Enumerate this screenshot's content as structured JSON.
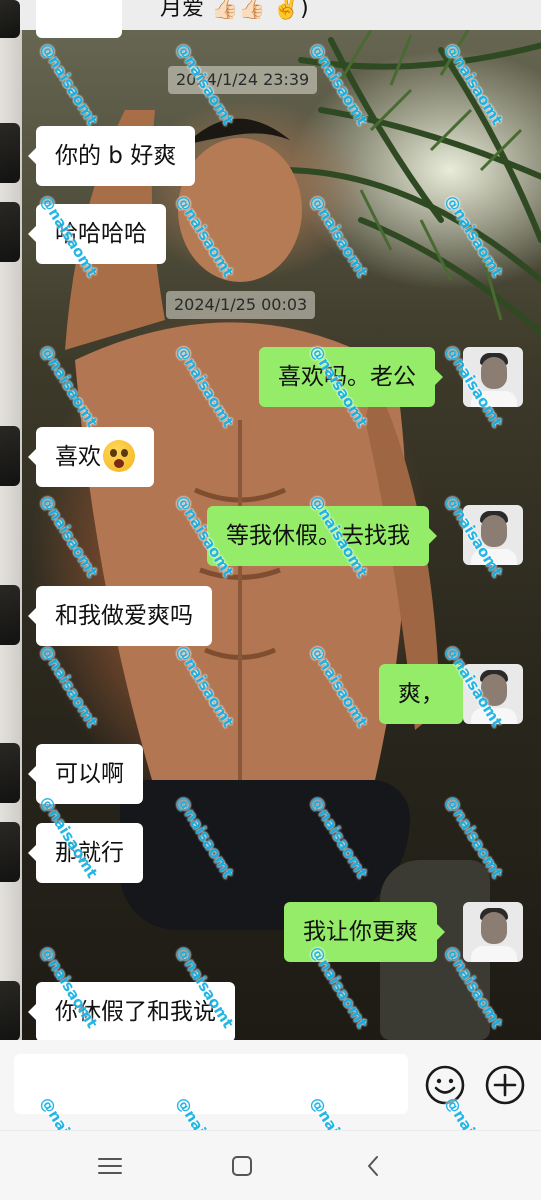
{
  "chat": {
    "header_title": "月爱 👍🏻👍🏻 ✌️)",
    "timestamps": [
      "2024/1/24 23:39",
      "2024/1/25 00:03"
    ],
    "messages": [
      {
        "side": "in",
        "text": "你的 b 好爽"
      },
      {
        "side": "in",
        "text": "哈哈哈哈"
      },
      {
        "side": "out",
        "text": "喜欢吗。老公"
      },
      {
        "side": "in",
        "text": "喜欢",
        "emoji": "astonished-face"
      },
      {
        "side": "out",
        "text": "等我休假。去找我"
      },
      {
        "side": "in",
        "text": "和我做爱爽吗"
      },
      {
        "side": "out",
        "text": "爽，"
      },
      {
        "side": "in",
        "text": "可以啊"
      },
      {
        "side": "in",
        "text": "那就行"
      },
      {
        "side": "out",
        "text": "我让你更爽"
      },
      {
        "side": "in",
        "text": "你休假了和我说"
      }
    ]
  },
  "watermark": "@naisaomt",
  "input": {
    "value": "",
    "placeholder": ""
  },
  "icons": {
    "emoji_button": "smiley-icon",
    "plus_button": "plus-circle-icon",
    "nav_menu": "menu-icon",
    "nav_home": "home-square-icon",
    "nav_back": "back-chevron-icon"
  },
  "colors": {
    "out_bubble": "#95ec69",
    "in_bubble": "#ffffff",
    "watermark": "#19b3e6"
  }
}
